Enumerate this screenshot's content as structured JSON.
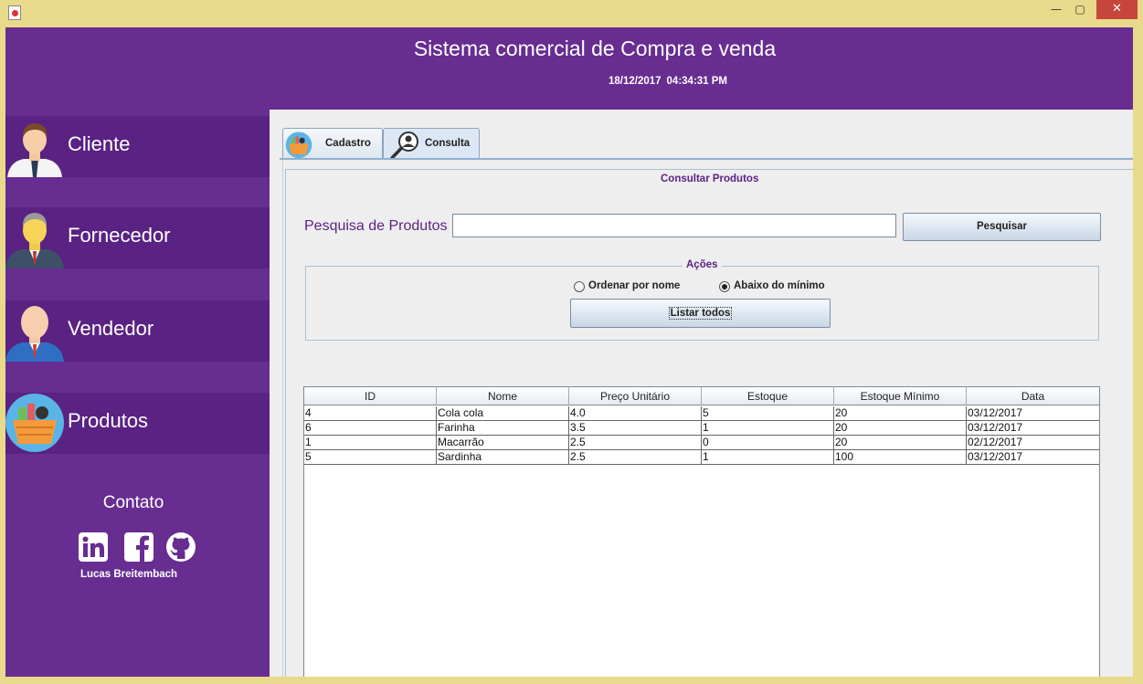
{
  "app": {
    "title": "Sistema comercial de Compra e venda",
    "date": "18/12/2017",
    "time": "04:34:31 PM"
  },
  "window_controls": {
    "minimize": "—",
    "maximize": "▢",
    "close": "✕"
  },
  "sidebar": {
    "items": [
      {
        "label": "Cliente",
        "icon": "businessman-icon"
      },
      {
        "label": "Fornecedor",
        "icon": "gray-haired-man-icon"
      },
      {
        "label": "Vendedor",
        "icon": "salesman-icon"
      },
      {
        "label": "Produtos",
        "icon": "basket-icon"
      }
    ],
    "contact_title": "Contato",
    "social": [
      "linkedin-icon",
      "facebook-icon",
      "github-icon"
    ],
    "author": "Lucas Breitembach"
  },
  "tabs": [
    {
      "label": "Cadastro",
      "icon": "basket-icon"
    },
    {
      "label": "Consulta",
      "icon": "search-person-icon"
    }
  ],
  "consulta": {
    "panel_title": "Consultar Produtos",
    "search_label": "Pesquisa de Produtos",
    "search_value": "",
    "search_button": "Pesquisar",
    "actions_title": "Ações",
    "radio_sort": "Ordenar por nome",
    "radio_below_min": "Abaixo do mínimo",
    "radio_selected": "Abaixo do mínimo",
    "list_all_button": "Listar todos"
  },
  "table": {
    "columns": [
      "ID",
      "Nome",
      "Preço Unitário",
      "Estoque",
      "Estoque Mínimo",
      "Data"
    ],
    "rows": [
      [
        "4",
        "Cola cola",
        "4.0",
        "5",
        "20",
        "03/12/2017"
      ],
      [
        "6",
        "Farinha",
        "3.5",
        "1",
        "20",
        "03/12/2017"
      ],
      [
        "1",
        "Macarrão",
        "2.5",
        "0",
        "20",
        "02/12/2017"
      ],
      [
        "5",
        "Sardinha",
        "2.5",
        "1",
        "100",
        "03/12/2017"
      ]
    ]
  },
  "colors": {
    "purple": "#672d91",
    "purple_dark": "#5a2282",
    "label_purple": "#5c1f86"
  }
}
